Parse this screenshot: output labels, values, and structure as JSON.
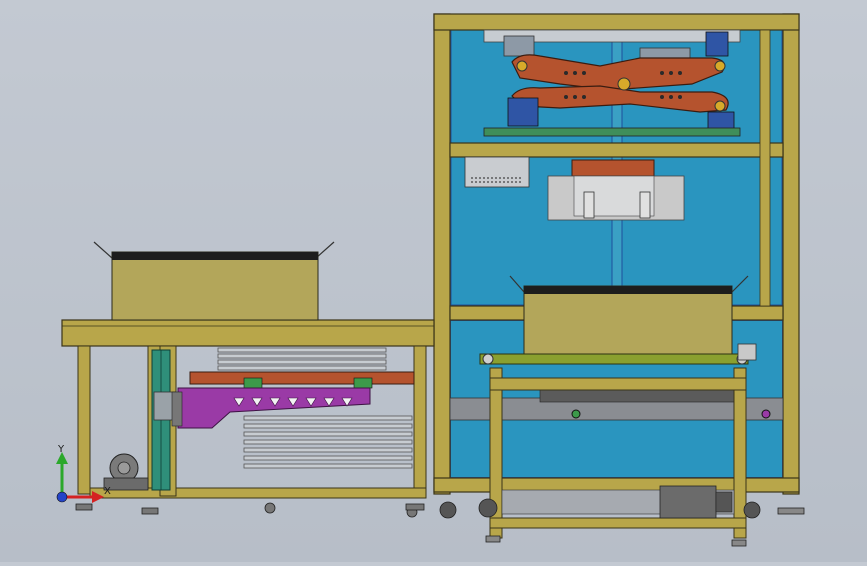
{
  "viewport": {
    "background": "#bfc5cf",
    "triad": {
      "y_label": "Y",
      "x_label": "X"
    }
  },
  "colors": {
    "frame": "#b8a64a",
    "frame_edge": "#3a3418",
    "panel": "#2a95bf",
    "panel_border": "#1f4f9c",
    "arm": "#b5532e",
    "knob": "#d7aa2a",
    "magenta": "#9a3aa6",
    "steel": "#a9adb4",
    "roller": "#8aa02f",
    "motor": "#6b6b6b"
  }
}
